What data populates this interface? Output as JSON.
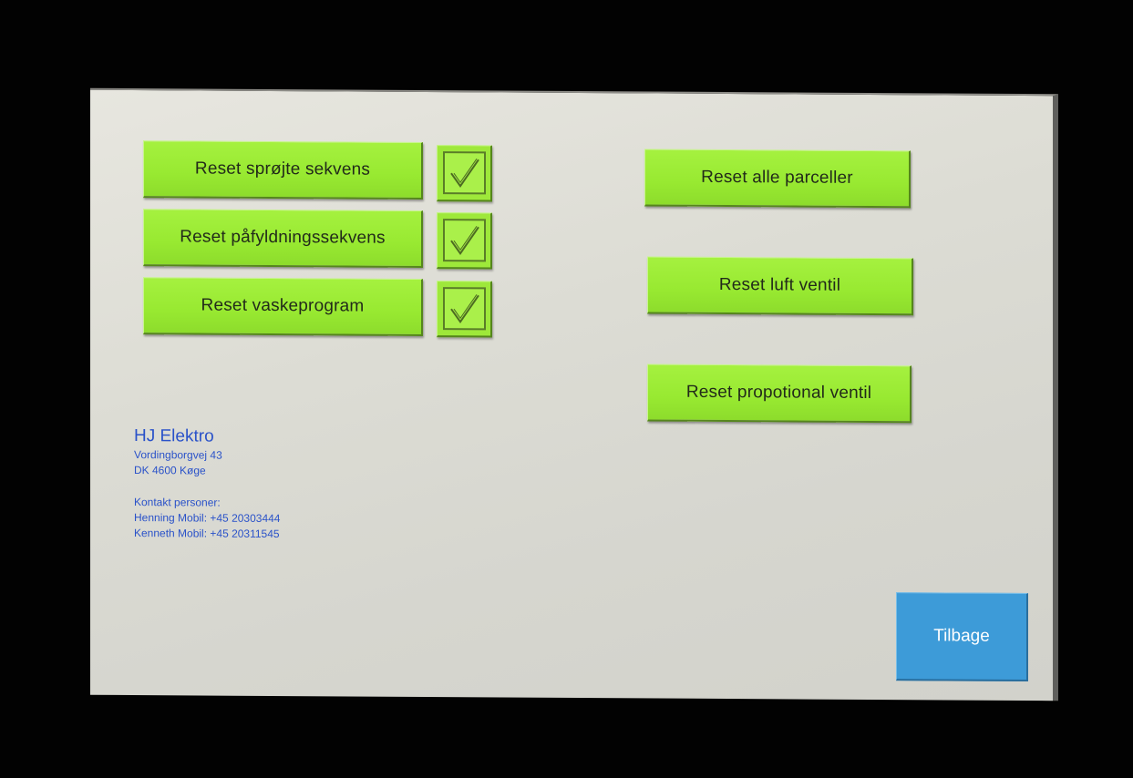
{
  "buttons": {
    "reset_sprojte": "Reset sprøjte sekvens",
    "reset_pafyldning": "Reset påfyldningssekvens",
    "reset_vaske": "Reset vaskeprogram",
    "reset_parceller": "Reset alle parceller",
    "reset_luft": "Reset luft ventil",
    "reset_propotional": "Reset propotional ventil",
    "back": "Tilbage"
  },
  "checkboxes": {
    "sprojte_checked": true,
    "pafyldning_checked": true,
    "vaske_checked": true
  },
  "contact": {
    "company": "HJ Elektro",
    "street": "Vordingborgvej 43",
    "city": "DK 4600  Køge",
    "persons_heading": "Kontakt personer:",
    "person1": "Henning  Mobil:  +45 20303444",
    "person2": "Kenneth  Mobil:  +45 20311545"
  },
  "colors": {
    "button_green": "#9ee83a",
    "back_blue": "#3d9bd8",
    "contact_text": "#2a52c9",
    "screen_bg": "#dcdcd4"
  },
  "icons": {
    "checkbox": "checkmark-icon"
  }
}
